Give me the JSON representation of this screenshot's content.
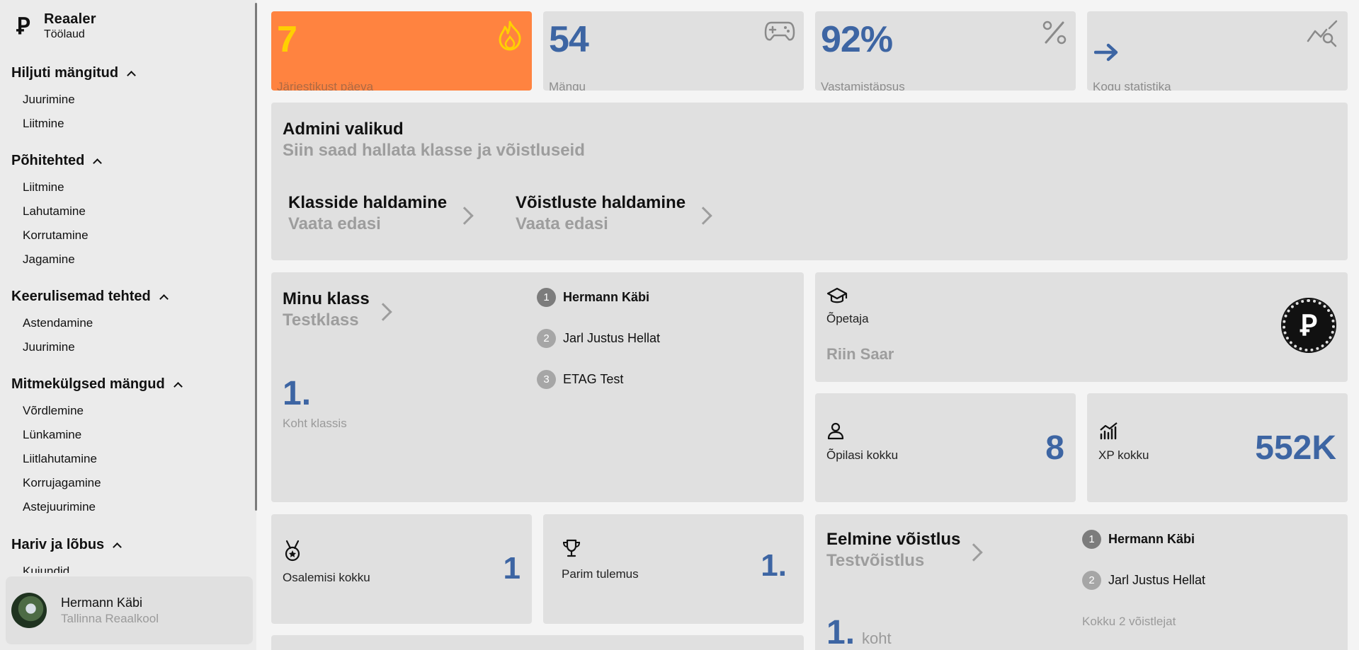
{
  "app": {
    "name": "Reaaler",
    "subtitle": "Töölaud",
    "logo_letter": "Ꝑ"
  },
  "sidebar": {
    "sections": [
      {
        "title": "Hiljuti mängitud",
        "items": [
          "Juurimine",
          "Liitmine"
        ]
      },
      {
        "title": "Põhitehted",
        "items": [
          "Liitmine",
          "Lahutamine",
          "Korrutamine",
          "Jagamine"
        ]
      },
      {
        "title": "Keerulisemad tehted",
        "items": [
          "Astendamine",
          "Juurimine"
        ]
      },
      {
        "title": "Mitmekülgsed mängud",
        "items": [
          "Võrdlemine",
          "Lünkamine",
          "Liitlahutamine",
          "Korrujagamine",
          "Astejuurimine"
        ]
      },
      {
        "title": "Hariv ja lõbus",
        "items": [
          "Kujundid"
        ]
      }
    ],
    "user": {
      "name": "Hermann Käbi",
      "school": "Tallinna Reaalkool"
    }
  },
  "stats": [
    {
      "value": "7",
      "label": "Järjestikust päeva",
      "icon": "flame-icon"
    },
    {
      "value": "54",
      "label": "Mängu",
      "icon": "gamepad-icon"
    },
    {
      "value": "92%",
      "label": "Vastamistäpsus",
      "icon": "percent-icon"
    },
    {
      "value": "",
      "label": "Kogu statistika",
      "icon": "arrow-right-icon"
    }
  ],
  "admin": {
    "title": "Admini valikud",
    "subtitle": "Siin saad hallata klasse ja võistluseid",
    "links": [
      {
        "title": "Klasside haldamine",
        "sub": "Vaata edasi"
      },
      {
        "title": "Võistluste haldamine",
        "sub": "Vaata edasi"
      }
    ]
  },
  "my_class": {
    "title": "Minu klass",
    "subtitle": "Testklass",
    "rank": "1.",
    "rank_label": "Koht klassis",
    "leaderboard": [
      {
        "pos": "1",
        "name": "Hermann Käbi"
      },
      {
        "pos": "2",
        "name": "Jarl Justus Hellat"
      },
      {
        "pos": "3",
        "name": "ETAG Test"
      }
    ]
  },
  "teacher": {
    "label": "Õpetaja",
    "name": "Riin Saar"
  },
  "students": {
    "label": "Õpilasi kokku",
    "value": "8"
  },
  "xp": {
    "label": "XP kokku",
    "value": "552K"
  },
  "participations": {
    "label": "Osalemisi kokku",
    "value": "1"
  },
  "best": {
    "label": "Parim tulemus",
    "value": "1."
  },
  "last_comp": {
    "title": "Eelmine võistlus",
    "subtitle": "Testvõistlus",
    "rank": "1.",
    "rank_suffix": "koht",
    "total": "Kokku 2 võistlejat",
    "leaderboard": [
      {
        "pos": "1",
        "name": "Hermann Käbi"
      },
      {
        "pos": "2",
        "name": "Jarl Justus Hellat"
      }
    ]
  },
  "colors": {
    "accent_blue": "#3d65a3",
    "streak_orange": "#ff8340",
    "streak_yellow": "#ffd000"
  }
}
